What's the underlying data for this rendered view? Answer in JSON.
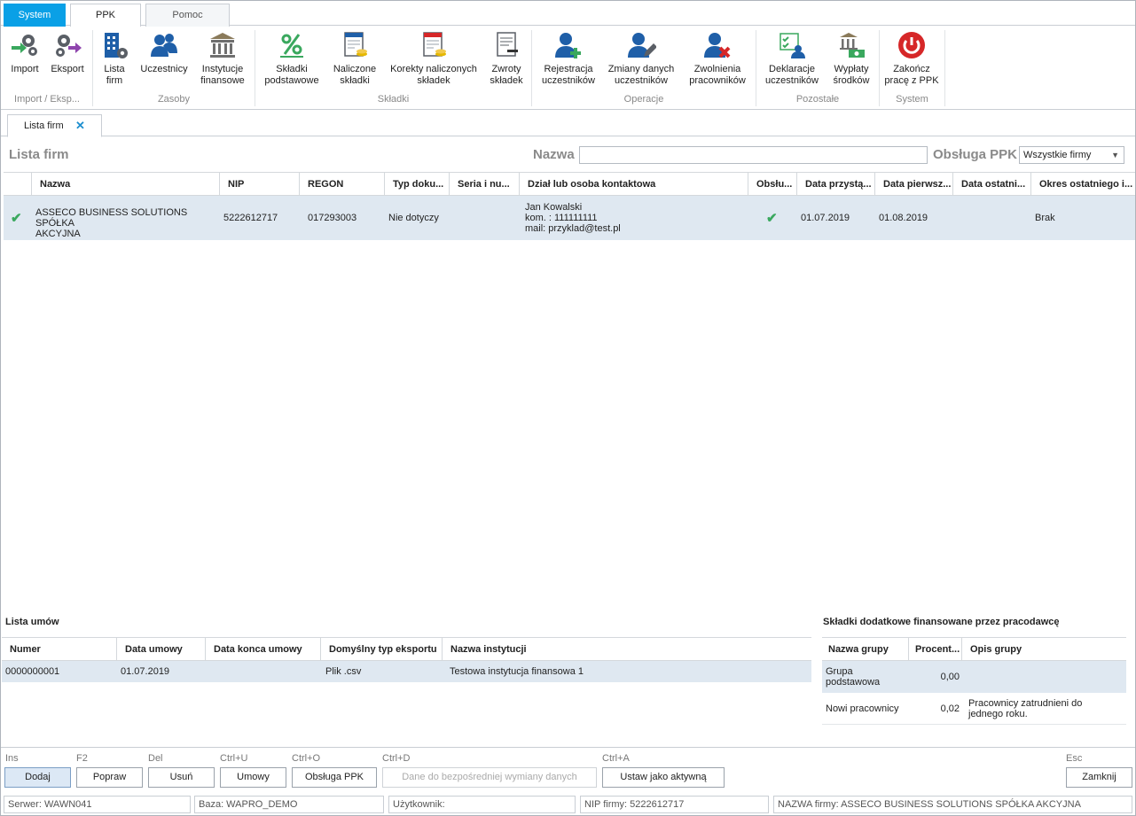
{
  "menu_tabs": [
    "System",
    "PPK",
    "Pomoc"
  ],
  "ribbon": {
    "buttons": {
      "import": "Import",
      "eksport": "Eksport",
      "lista_firm": [
        "Lista",
        "firm"
      ],
      "uczestnicy": "Uczestnicy",
      "instytucje": [
        "Instytucje",
        "finansowe"
      ],
      "skladki_podstawowe": [
        "Składki",
        "podstawowe"
      ],
      "naliczone": [
        "Naliczone",
        "składki"
      ],
      "korekty": [
        "Korekty naliczonych",
        "składek"
      ],
      "zwroty": [
        "Zwroty",
        "składek"
      ],
      "rejestracja": [
        "Rejestracja",
        "uczestników"
      ],
      "zmiany": [
        "Zmiany danych",
        "uczestników"
      ],
      "zwolnienia": [
        "Zwolnienia",
        "pracowników"
      ],
      "deklaracje": [
        "Deklaracje",
        "uczestników"
      ],
      "wyplaty": [
        "Wypłaty",
        "środków"
      ],
      "zakoncz": [
        "Zakończ",
        "pracę z PPK"
      ]
    },
    "groups": [
      "Import / Eksp...",
      "Zasoby",
      "Składki",
      "Operacje",
      "Pozostałe",
      "System"
    ]
  },
  "doc_tab": {
    "label": "Lista firm",
    "close": "✕"
  },
  "filter": {
    "title": "Lista firm",
    "name_label": "Nazwa",
    "name_value": "",
    "ppk_label": "Obsługa PPK",
    "ppk_value": "Wszystkie firmy"
  },
  "firms_grid": {
    "columns": [
      "Nazwa",
      "NIP",
      "REGON",
      "Typ doku...",
      "Seria i nu...",
      "Dział lub osoba kontaktowa",
      "Obsłu...",
      "Data przystą...",
      "Data pierwsz...",
      "Data ostatni...",
      "Okres ostatniego i..."
    ],
    "rows": [
      {
        "active": "✔",
        "nazwa": [
          "ASSECO BUSINESS SOLUTIONS SPÓŁKA",
          "AKCYJNA"
        ],
        "nip": "5222612717",
        "regon": "017293003",
        "typ": "Nie dotyczy",
        "seria": "",
        "kontakt": [
          "Jan Kowalski",
          "kom. : 111111111",
          "mail: przyklad@test.pl"
        ],
        "obsluga": "✔",
        "data_przyst": "01.07.2019",
        "data_pierwsz": "01.08.2019",
        "data_ostatni": "",
        "okres": "Brak"
      }
    ]
  },
  "umowy": {
    "title": "Lista umów",
    "columns": [
      "Numer",
      "Data umowy",
      "Data konca umowy",
      "Domyślny typ eksportu",
      "Nazwa instytucji"
    ],
    "rows": [
      {
        "numer": "0000000001",
        "data": "01.07.2019",
        "koniec": "",
        "typ": "Plik .csv",
        "instytucja": "Testowa instytucja finansowa 1"
      }
    ]
  },
  "skladki_dod": {
    "title": "Składki dodatkowe finansowane przez pracodawcę",
    "columns": [
      "Nazwa grupy",
      "Procent...",
      "Opis grupy"
    ],
    "rows": [
      {
        "nazwa": [
          "Grupa",
          "podstawowa"
        ],
        "procent": "0,00",
        "opis": [
          "",
          ""
        ]
      },
      {
        "nazwa": [
          "Nowi pracownicy",
          ""
        ],
        "procent": "0,02",
        "opis": [
          "Pracownicy zatrudnieni do",
          "jednego roku."
        ]
      }
    ]
  },
  "actions": [
    {
      "shortcut": "Ins",
      "label": "Dodaj"
    },
    {
      "shortcut": "F2",
      "label": "Popraw"
    },
    {
      "shortcut": "Del",
      "label": "Usuń"
    },
    {
      "shortcut": "Ctrl+U",
      "label": "Umowy"
    },
    {
      "shortcut": "Ctrl+O",
      "label": "Obsługa PPK"
    },
    {
      "shortcut": "Ctrl+D",
      "label": "Dane do bezpośredniej wymiany danych"
    },
    {
      "shortcut": "Ctrl+A",
      "label": "Ustaw jako aktywną"
    },
    {
      "shortcut": "Esc",
      "label": "Zamknij"
    }
  ],
  "status_bar": {
    "serwer": "Serwer: WAWN041",
    "baza": "Baza: WAPRO_DEMO",
    "uzytkownik": "Użytkownik:",
    "nip": "NIP firmy: 5222612717",
    "nazwa": "NAZWA firmy: ASSECO BUSINESS SOLUTIONS SPÓŁKA AKCYJNA"
  },
  "colors": {
    "accent": "#0aa0e6",
    "selected_row": "#dfe8f1",
    "check": "#3aa85e",
    "power": "#d62728"
  }
}
